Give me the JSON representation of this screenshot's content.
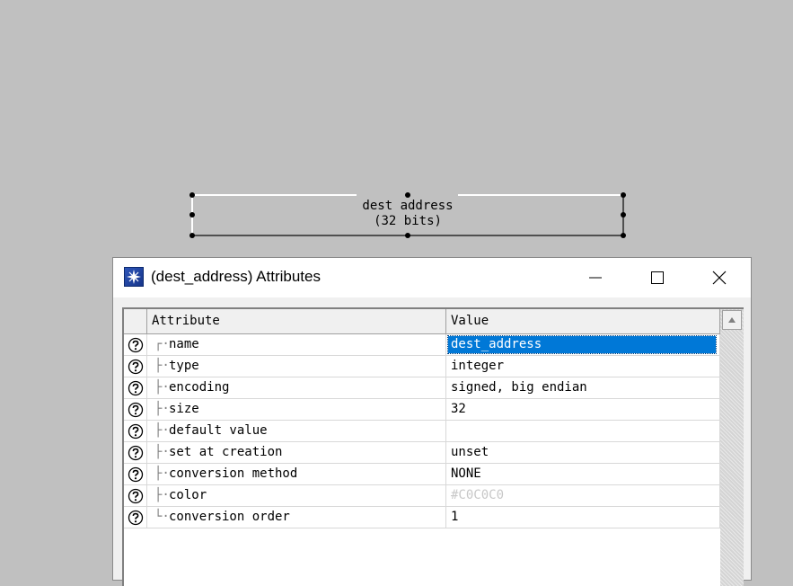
{
  "field": {
    "label_line1": "dest address",
    "label_line2": "(32 bits)"
  },
  "dialog": {
    "title": "(dest_address) Attributes",
    "icon": "app-star-icon"
  },
  "grid": {
    "headers": [
      "Attribute",
      "Value"
    ],
    "rows": [
      {
        "attribute": "name",
        "value": "dest_address",
        "selected": true
      },
      {
        "attribute": "type",
        "value": "integer"
      },
      {
        "attribute": "encoding",
        "value": "signed, big endian"
      },
      {
        "attribute": "size",
        "value": "32"
      },
      {
        "attribute": "default value",
        "value": ""
      },
      {
        "attribute": "set at creation",
        "value": "unset"
      },
      {
        "attribute": "conversion method",
        "value": "NONE"
      },
      {
        "attribute": "color",
        "value": "#C0C0C0",
        "dim": true
      },
      {
        "attribute": "conversion order",
        "value": "1"
      }
    ]
  },
  "colors": {
    "selection": "#0078d7",
    "canvas": "#c0c0c0"
  }
}
